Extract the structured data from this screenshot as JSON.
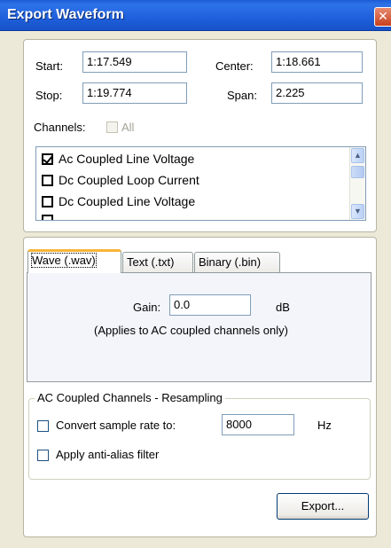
{
  "window": {
    "title": "Export Waveform",
    "close_glyph": "✕"
  },
  "range": {
    "start_label": "Start:",
    "start_value": "1:17.549",
    "center_label": "Center:",
    "center_value": "1:18.661",
    "stop_label": "Stop:",
    "stop_value": "1:19.774",
    "span_label": "Span:",
    "span_value": "2.225"
  },
  "channels": {
    "label": "Channels:",
    "all_label": "All",
    "all_checked": false,
    "items": [
      {
        "label": "Ac Coupled Line Voltage",
        "checked": true
      },
      {
        "label": "Dc Coupled Loop Current",
        "checked": false
      },
      {
        "label": "Dc Coupled Line Voltage",
        "checked": false
      }
    ]
  },
  "tabs": [
    {
      "label": "Wave (.wav)",
      "active": true
    },
    {
      "label": "Text (.txt)",
      "active": false
    },
    {
      "label": "Binary (.bin)",
      "active": false
    }
  ],
  "wave": {
    "gain_label": "Gain:",
    "gain_value": "0.0",
    "gain_unit": "dB",
    "note": "(Applies to AC coupled channels only)"
  },
  "resampling": {
    "group_title": "AC Coupled Channels - Resampling",
    "convert_label": "Convert sample rate to:",
    "convert_checked": false,
    "rate_value": "8000",
    "rate_unit": "Hz",
    "antialias_label": "Apply anti-alias filter",
    "antialias_checked": false
  },
  "actions": {
    "export_label": "Export..."
  },
  "colors": {
    "titlebar": "#2e73e8",
    "dialog_bg": "#ece9d8",
    "tab_highlight": "#f8b538"
  }
}
